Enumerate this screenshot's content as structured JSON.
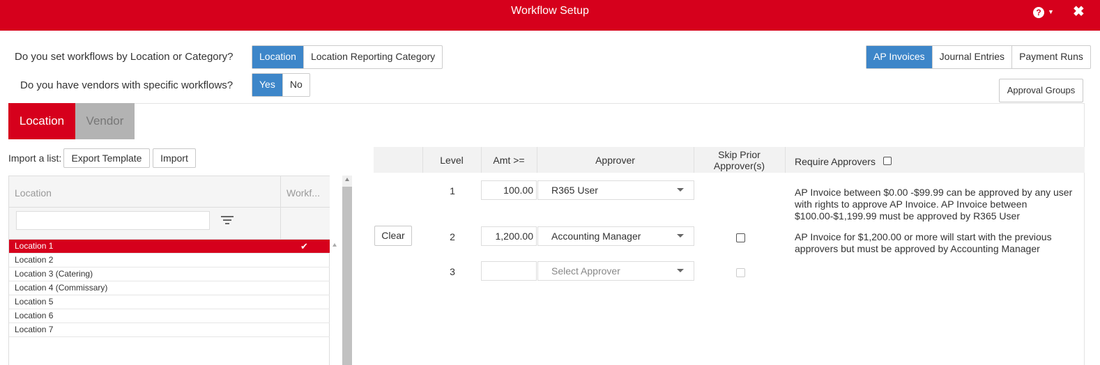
{
  "window": {
    "title": "Workflow Setup"
  },
  "questions": {
    "workflow_by": {
      "label": "Do you set workflows by Location or Category?",
      "options": [
        "Location",
        "Location Reporting Category"
      ],
      "selected": "Location"
    },
    "vendor_specific": {
      "label": "Do you have vendors with specific workflows?",
      "options": [
        "Yes",
        "No"
      ],
      "selected": "Yes"
    }
  },
  "doc_types": {
    "options": [
      "AP Invoices",
      "Journal Entries",
      "Payment Runs"
    ],
    "selected": "AP Invoices"
  },
  "approval_groups_label": "Approval Groups",
  "tabs": {
    "location": "Location",
    "vendor": "Vendor",
    "active": "Location"
  },
  "import": {
    "label": "Import a list:",
    "export_template": "Export Template",
    "import_button": "Import"
  },
  "location_grid": {
    "columns": [
      "Location",
      "Workf..."
    ],
    "filter_value": "",
    "rows": [
      {
        "name": "Location 1",
        "selected": true,
        "checked": true
      },
      {
        "name": "Location 2",
        "selected": false,
        "checked": false
      },
      {
        "name": "Location 3 (Catering)",
        "selected": false,
        "checked": false
      },
      {
        "name": "Location 4 (Commissary)",
        "selected": false,
        "checked": false
      },
      {
        "name": "Location 5",
        "selected": false,
        "checked": false
      },
      {
        "name": "Location 6",
        "selected": false,
        "checked": false
      },
      {
        "name": "Location 7",
        "selected": false,
        "checked": false
      }
    ]
  },
  "workflow": {
    "headers": {
      "level": "Level",
      "amt": "Amt >=",
      "approver": "Approver",
      "skip_line1": "Skip Prior",
      "skip_line2": "Approver(s)",
      "require": "Require Approvers"
    },
    "clear_label": "Clear",
    "levels": [
      {
        "level": "1",
        "amount": "100.00",
        "approver": "R365 User",
        "skip": false,
        "description": "AP Invoice between $0.00 -$99.99 can be approved by any user with rights to approve AP Invoice. AP Invoice between $100.00-$1,199.99 must be approved by R365 User"
      },
      {
        "level": "2",
        "amount": "1,200.00",
        "approver": "Accounting Manager",
        "skip": false,
        "description": "AP Invoice for $1,200.00 or more will start with the previous approvers but must be approved by Accounting Manager"
      },
      {
        "level": "3",
        "amount": "",
        "approver_placeholder": "Select Approver",
        "skip": false,
        "description": ""
      }
    ]
  },
  "colors": {
    "brand_red": "#d6001c",
    "active_blue": "#3d86c9"
  },
  "icons": {
    "help": "help-icon",
    "close": "close-icon",
    "filter": "filter-icon",
    "check": "checkmark-icon"
  }
}
